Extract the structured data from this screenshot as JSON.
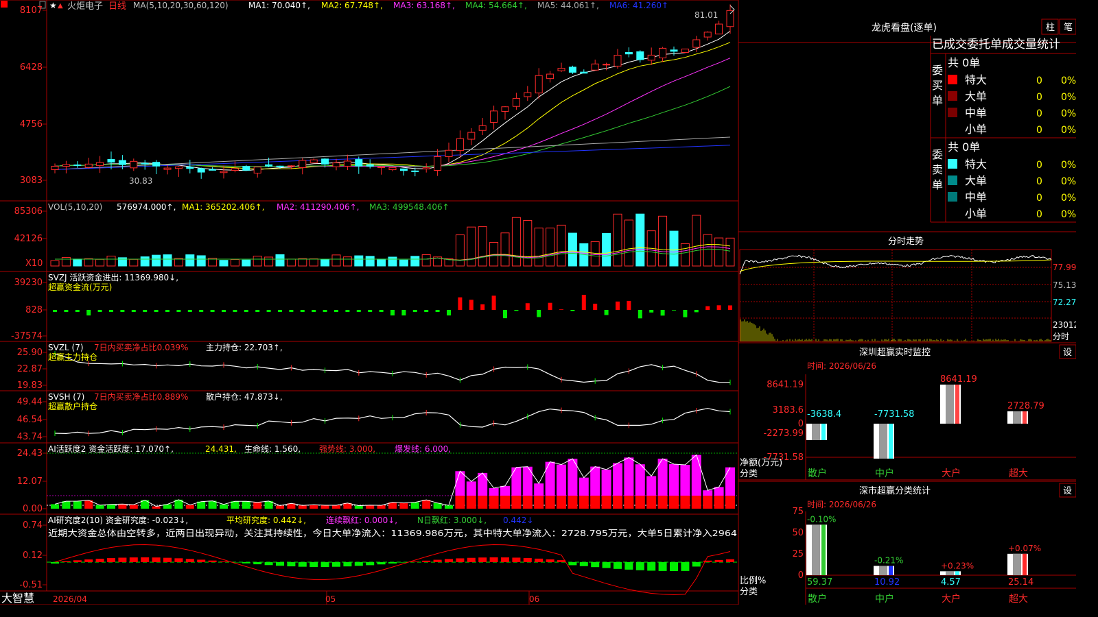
{
  "colors": {
    "up": "#ff2a2a",
    "down": "#33ffff",
    "grid": "#aa0000",
    "ma1": "#ffffff",
    "ma2": "#ffff00",
    "ma3": "#ff33ff",
    "ma4": "#33cc33",
    "ma5": "#aaaaaa",
    "ma6": "#2233ff",
    "vol_ma3": "#33cc33",
    "bg": "#000000"
  },
  "price_panel": {
    "stock_name": "火炬电子",
    "period": "日线",
    "ma_params": "MA(5,10,20,30,60,120)",
    "ma_labels": [
      "MA1: 70.040↑,",
      "MA2: 67.748↑,",
      "MA3: 63.168↑,",
      "MA4: 54.664↑,",
      "MA5: 44.061↑,",
      "MA6: 41.260↑"
    ],
    "y_ticks": [
      "8107",
      "6428",
      "4756",
      "3083"
    ],
    "high_label": "81.01",
    "low_label": "30.83"
  },
  "volume_panel": {
    "header": "VOL(5,10,20)",
    "value": "576974.000↑,",
    "ma_labels": [
      "MA1: 365202.406↑,",
      "MA2: 411290.406↑,",
      "MA3: 499548.406↑"
    ],
    "y_ticks": [
      "85306",
      "42126"
    ],
    "unit": "X10"
  },
  "svzj_panel": {
    "header": "SVZJ  活跃资金进出: 11369.980↓,",
    "subtitle": "超赢资金流(万元)",
    "y_ticks": [
      "39230",
      "828",
      "-37574"
    ]
  },
  "svzl_panel": {
    "header_a": "SVZL (7)",
    "header_b": "7日内买卖净占比0.039%",
    "header_c": "主力持仓: 22.703↑,",
    "subtitle": "超赢主力持仓",
    "y_ticks": [
      "25.90",
      "22.87",
      "19.83"
    ]
  },
  "svsh_panel": {
    "header_a": "SVSH (7)",
    "header_b": "7日内买卖净占比0.889%",
    "header_c": "散户持仓: 47.873↓,",
    "subtitle": "超赢散户持仓",
    "y_ticks": [
      "49.44",
      "46.54",
      "43.74"
    ]
  },
  "ai_active_panel": {
    "header_a": "AI活跃度2 资金活跃度: 17.070↑,",
    "header_b": "24.431,",
    "header_c": "生命线: 1.560,",
    "header_d": "强势线: 3.000,",
    "header_e": "爆发线: 6.000,",
    "y_ticks": [
      "24.43",
      "12.07",
      "0.00"
    ]
  },
  "ai_research_panel": {
    "header_a": "AI研究度2(10) 资金研究度: -0.023↓,",
    "header_b": "平均研究度: 0.442↓,",
    "header_c": "连续飘红: 0.000↓,",
    "header_d": "N日飘红: 3.000↓,",
    "header_e": "0.442↓",
    "comment": "近期大资金总体由空转多，近两日出现异动，关注其持续性，今日大单净流入：11369.986万元，其中特大单净流入：2728.795万元，大单5日累计净入2964",
    "y_ticks": [
      "0.74",
      "0.12",
      "-0.51"
    ]
  },
  "x_axis": {
    "brand": "大智慧",
    "labels": [
      "2026/04",
      "05",
      "06"
    ]
  },
  "lhb": {
    "title": "龙虎看盘(逐单)",
    "btn_bar": "柱",
    "btn_pen": "笔",
    "head": "已成交委托单成交量统计",
    "buy": {
      "side": "委买单",
      "total": "共 0单",
      "rows": [
        {
          "name": "特大",
          "qty": "0",
          "pct": "0%",
          "color": "#ff0000"
        },
        {
          "name": "大单",
          "qty": "0",
          "pct": "0%",
          "color": "#8b0000"
        },
        {
          "name": "中单",
          "qty": "0",
          "pct": "0%",
          "color": "#7a0000"
        },
        {
          "name": "小单",
          "qty": "0",
          "pct": "0%",
          "color": "#000000"
        }
      ]
    },
    "sell": {
      "side": "委卖单",
      "total": "共 0单",
      "rows": [
        {
          "name": "特大",
          "qty": "0",
          "pct": "0%",
          "color": "#33ffff"
        },
        {
          "name": "大单",
          "qty": "0",
          "pct": "0%",
          "color": "#008b8b"
        },
        {
          "name": "中单",
          "qty": "0",
          "pct": "0%",
          "color": "#007a7a"
        },
        {
          "name": "小单",
          "qty": "0",
          "pct": "0%",
          "color": "#000000"
        }
      ]
    }
  },
  "intraday": {
    "title": "分时走势",
    "prices": [
      "77.99",
      "75.13",
      "72.27"
    ],
    "vol_label": "23012",
    "fen": "分时"
  },
  "monitor": {
    "title": "深圳超赢实时监控",
    "btn": "设",
    "time_label": "时间: 2026/06/26",
    "y_ticks": [
      "8641.19",
      "3183.6",
      "0",
      "-2273.99",
      "-7731.58"
    ],
    "unit_a": "净额(万元)",
    "unit_b": "分类",
    "bars": [
      {
        "cat": "散户",
        "value": -3638.4,
        "label": "-3638.4"
      },
      {
        "cat": "中户",
        "value": -7731.58,
        "label": "-7731.58"
      },
      {
        "cat": "大户",
        "value": 8641.19,
        "label": "8641.19"
      },
      {
        "cat": "超大",
        "value": 2728.79,
        "label": "2728.79"
      }
    ]
  },
  "classify": {
    "title": "深市超赢分类统计",
    "btn": "设",
    "time_label": "时间: 2026/06/26",
    "y_ticks": [
      "75",
      "50",
      "25",
      "0"
    ],
    "unit_a": "比例%",
    "unit_b": "分类",
    "bars": [
      {
        "cat": "散户",
        "pct": 59.37,
        "label": "59.37",
        "chg": "-0.10%"
      },
      {
        "cat": "中户",
        "pct": 10.92,
        "label": "10.92",
        "chg": "-0.21%"
      },
      {
        "cat": "大户",
        "pct": 4.57,
        "label": "4.57",
        "chg": "+0.23%"
      },
      {
        "cat": "超大",
        "pct": 25.14,
        "label": "25.14",
        "chg": "+0.07%"
      }
    ]
  }
}
